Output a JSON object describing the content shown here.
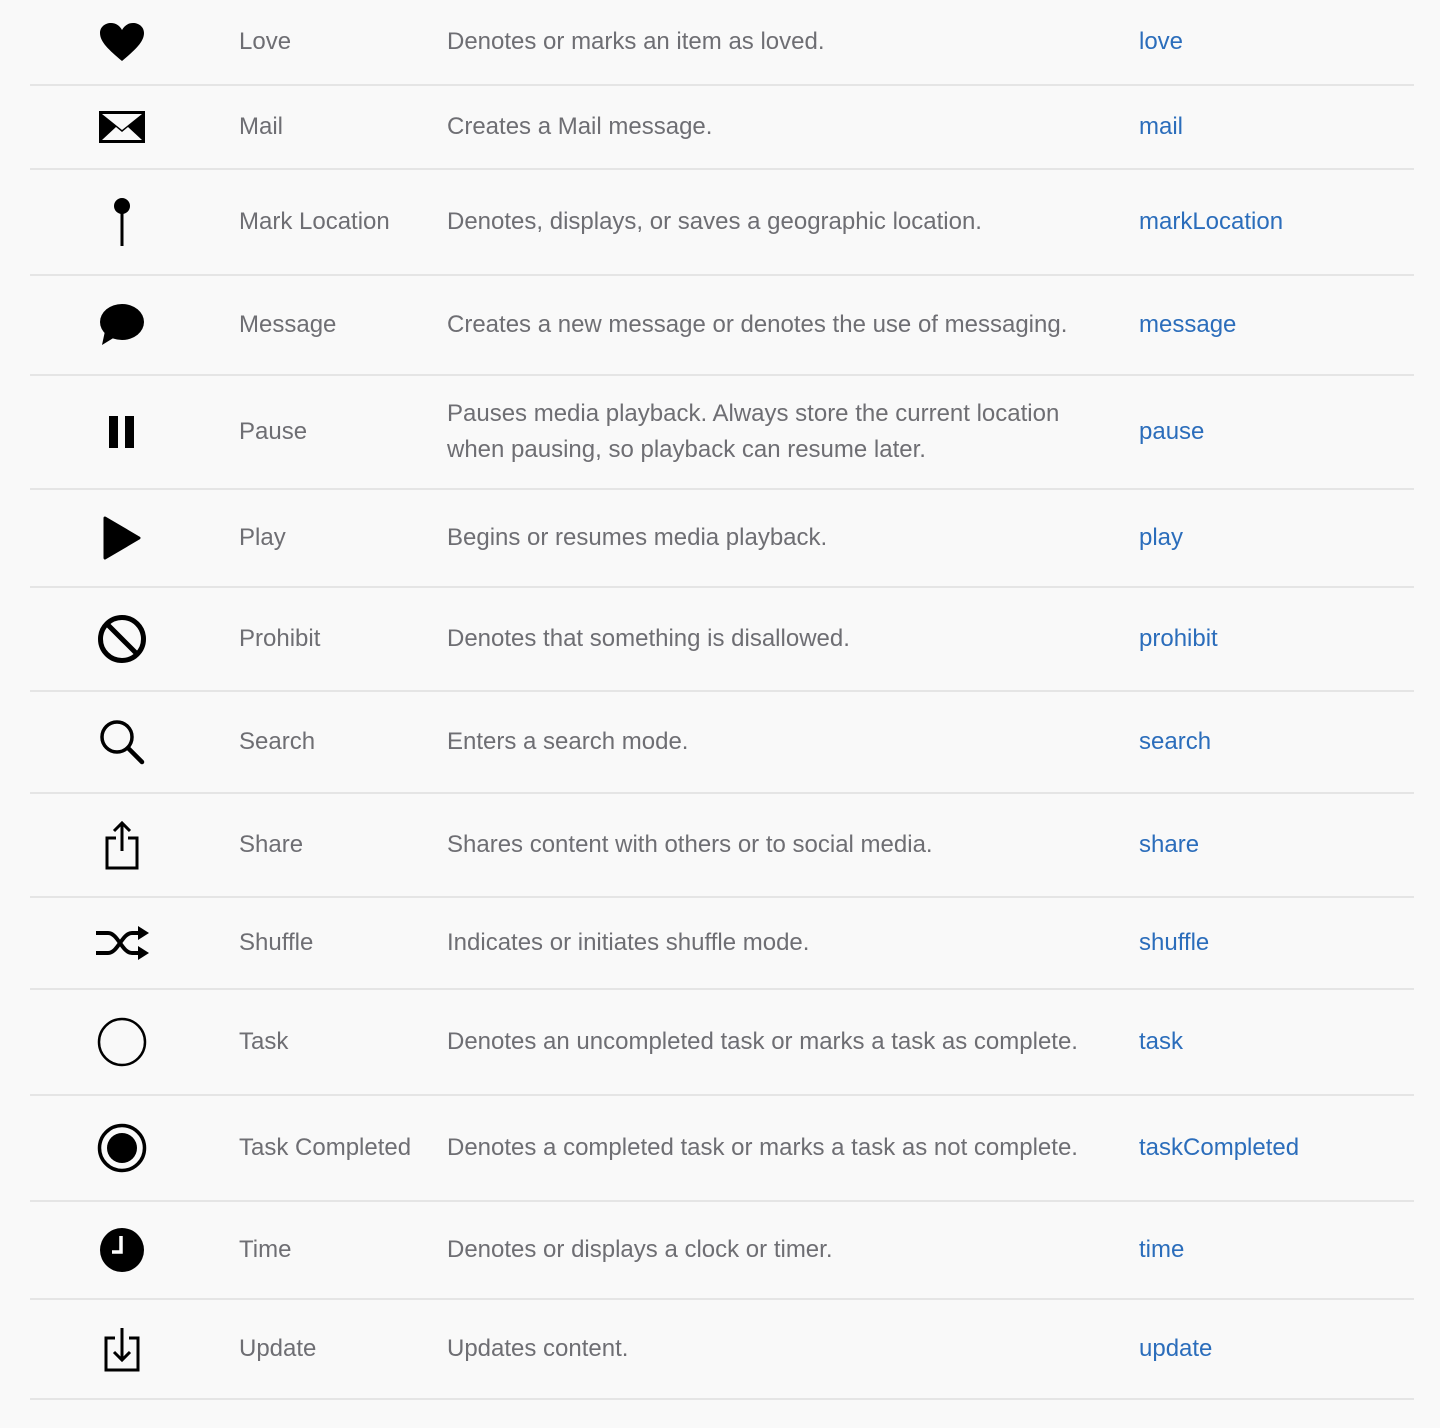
{
  "colors": {
    "background": "#f9f9f9",
    "divider": "#e5e5e5",
    "text": "#6e6e73",
    "link": "#2b6dbb",
    "icon": "#000000"
  },
  "rows": [
    {
      "icon": "heart-icon",
      "name": "Love",
      "description": "Denotes or marks an item as loved.",
      "link": "love"
    },
    {
      "icon": "envelope-icon",
      "name": "Mail",
      "description": "Creates a Mail message.",
      "link": "mail"
    },
    {
      "icon": "pin-icon",
      "name": "Mark Location",
      "description": "Denotes, displays, or saves a geographic location.",
      "link": "markLocation"
    },
    {
      "icon": "speech-bubble-icon",
      "name": "Message",
      "description": "Creates a new message or denotes the use of messaging.",
      "link": "message"
    },
    {
      "icon": "pause-icon",
      "name": "Pause",
      "description": "Pauses media playback. Always store the current location when pausing, so playback can resume later.",
      "link": "pause"
    },
    {
      "icon": "play-icon",
      "name": "Play",
      "description": "Begins or resumes media playback.",
      "link": "play"
    },
    {
      "icon": "prohibit-icon",
      "name": "Prohibit",
      "description": "Denotes that something is disallowed.",
      "link": "prohibit"
    },
    {
      "icon": "magnifier-icon",
      "name": "Search",
      "description": "Enters a search mode.",
      "link": "search"
    },
    {
      "icon": "share-icon",
      "name": "Share",
      "description": "Shares content with others or to social media.",
      "link": "share"
    },
    {
      "icon": "shuffle-icon",
      "name": "Shuffle",
      "description": "Indicates or initiates shuffle mode.",
      "link": "shuffle"
    },
    {
      "icon": "circle-outline-icon",
      "name": "Task",
      "description": "Denotes an uncompleted task or marks a task as complete.",
      "link": "task"
    },
    {
      "icon": "circle-filled-icon",
      "name": "Task Completed",
      "description": "Denotes a completed task or marks a task as not complete.",
      "link": "taskCompleted"
    },
    {
      "icon": "clock-icon",
      "name": "Time",
      "description": "Denotes or displays a clock or timer.",
      "link": "time"
    },
    {
      "icon": "update-icon",
      "name": "Update",
      "description": "Updates content.",
      "link": "update"
    }
  ]
}
